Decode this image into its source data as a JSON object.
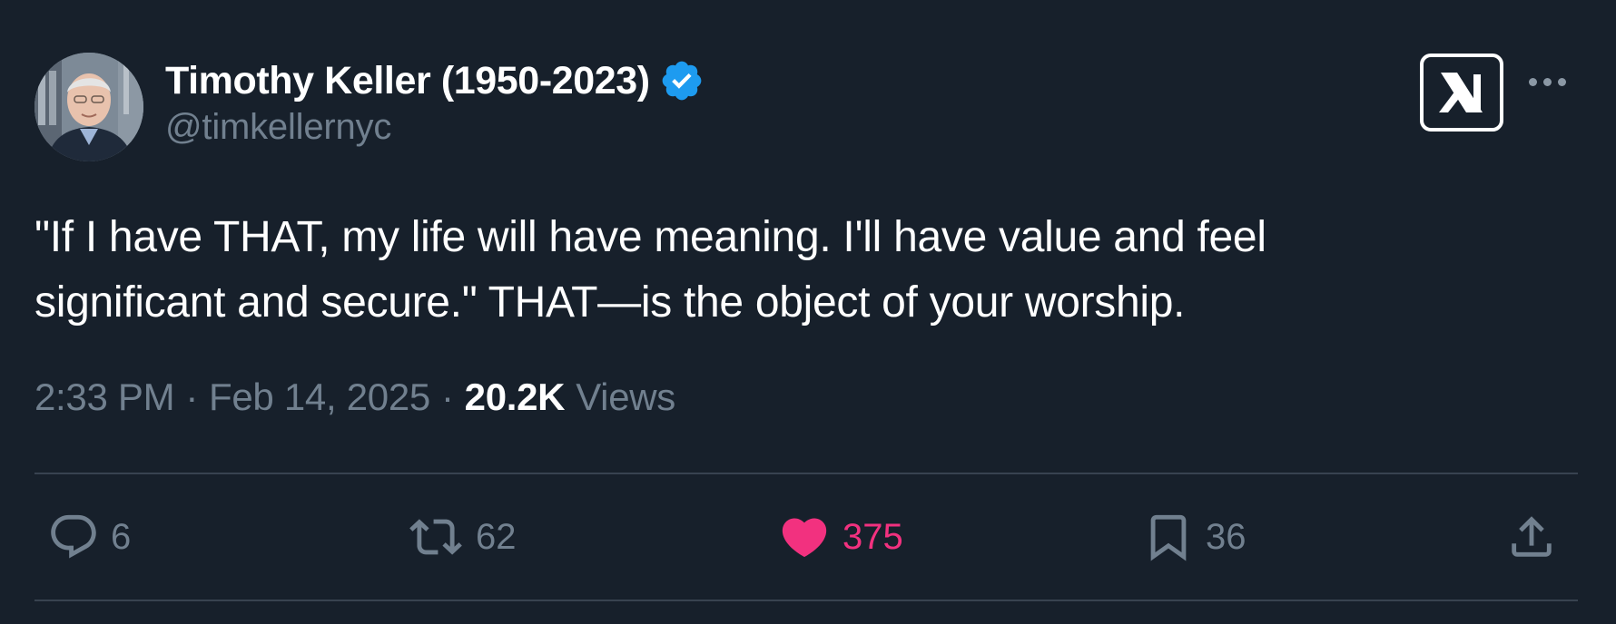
{
  "author": {
    "display_name": "Timothy Keller (1950-2023)",
    "handle": "@timkellernyc",
    "verified_icon": "verified-badge-icon",
    "avatar": "profile-photo"
  },
  "header": {
    "logo_icon": "x-grok-logo-icon",
    "more_icon": "more-options-icon"
  },
  "tweet": {
    "text": "\"If I have THAT, my life will have meaning. I'll have value and feel significant and secure.\" THAT—is the object of your worship."
  },
  "meta": {
    "time": "2:33 PM",
    "separator": "·",
    "date": "Feb 14, 2025",
    "views_count": "20.2K",
    "views_label": "Views"
  },
  "actions": {
    "reply": {
      "icon": "reply-icon",
      "count": "6"
    },
    "retweet": {
      "icon": "retweet-icon",
      "count": "62"
    },
    "like": {
      "icon": "heart-icon",
      "count": "375",
      "liked": true
    },
    "bookmark": {
      "icon": "bookmark-icon",
      "count": "36"
    },
    "share": {
      "icon": "share-icon"
    }
  },
  "colors": {
    "background": "#17202b",
    "text_primary": "#ffffff",
    "text_secondary": "#71808f",
    "verified_blue": "#1d9bf0",
    "like_pink": "#f2317f",
    "divider": "#384350"
  }
}
